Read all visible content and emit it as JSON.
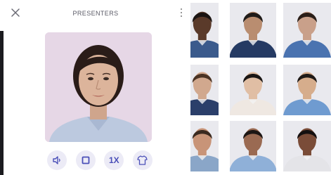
{
  "panel": {
    "title": "PRESENTERS",
    "controls": {
      "speed_label": "1X"
    }
  },
  "colors": {
    "accent": "#4a4fb8",
    "control_bg": "#ecebf6",
    "preview_bg": "#e6d7e6"
  },
  "icons": {
    "close": "close-icon",
    "menu": "more-vertical-icon",
    "volume": "volume-icon",
    "stop": "stop-icon",
    "shirt": "shirt-icon"
  },
  "presenters": [
    {
      "skin": "#5a3a2a",
      "hair": "#1a1412",
      "shirt": "#3a5a8c",
      "bg": "#e9e9ee"
    },
    {
      "skin": "#b98d70",
      "hair": "#1f1b19",
      "shirt": "#253a63",
      "bg": "#e9e9ee"
    },
    {
      "skin": "#c9a08a",
      "hair": "#2a1e18",
      "shirt": "#4a73b0",
      "bg": "#e9e9ee"
    },
    {
      "skin": "#d1a88e",
      "hair": "#4a3324",
      "shirt": "#2b3f6a",
      "bg": "#e9e9ee"
    },
    {
      "skin": "#e0bea4",
      "hair": "#1a1614",
      "shirt": "#efe8e2",
      "bg": "#e9e9ee"
    },
    {
      "skin": "#d6ad8c",
      "hair": "#1f1a17",
      "shirt": "#6f9bd0",
      "bg": "#e9e9ee"
    },
    {
      "skin": "#c89478",
      "hair": "#3a2a20",
      "shirt": "#8aa6c8",
      "bg": "#e9e9ee"
    },
    {
      "skin": "#9a6a52",
      "hair": "#1c1614",
      "shirt": "#8fb0d8",
      "bg": "#e9e9ee"
    },
    {
      "skin": "#7a4c38",
      "hair": "#141010",
      "shirt": "#e4e4e8",
      "bg": "#e9e9ee"
    }
  ]
}
